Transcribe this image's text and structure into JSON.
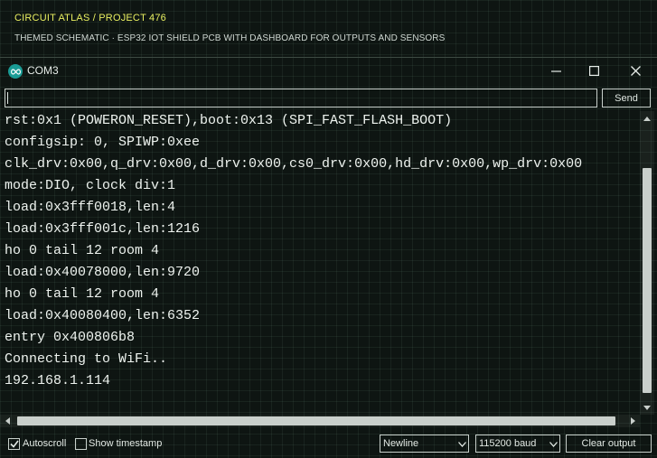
{
  "header": {
    "brand": "CIRCUIT ATLAS / PROJECT 476",
    "subtitle": "THEMED SCHEMATIC · ESP32 IOT SHIELD PCB WITH DASHBOARD FOR OUTPUTS AND SENSORS"
  },
  "window": {
    "title": "COM3",
    "icon": "arduino-infinity-icon",
    "controls": [
      "minimize-icon",
      "maximize-icon",
      "close-icon"
    ]
  },
  "send": {
    "input_value": "",
    "input_placeholder": "",
    "button_label": "Send"
  },
  "output": {
    "lines": [
      "rst:0x1 (POWERON_RESET),boot:0x13 (SPI_FAST_FLASH_BOOT)",
      "configsip: 0, SPIWP:0xee",
      "clk_drv:0x00,q_drv:0x00,d_drv:0x00,cs0_drv:0x00,hd_drv:0x00,wp_drv:0x00",
      "mode:DIO, clock div:1",
      "load:0x3fff0018,len:4",
      "load:0x3fff001c,len:1216",
      "ho 0 tail 12 room 4",
      "load:0x40078000,len:9720",
      "ho 0 tail 12 room 4",
      "load:0x40080400,len:6352",
      "entry 0x400806b8",
      "Connecting to WiFi..",
      "192.168.1.114"
    ],
    "highlight_color": "#e8ee3c"
  },
  "footer": {
    "autoscroll_label": "Autoscroll",
    "autoscroll_checked": true,
    "timestamp_label": "Show timestamp",
    "timestamp_checked": false,
    "line_ending": "Newline",
    "baud": "115200 baud",
    "clear_label": "Clear output"
  },
  "colors": {
    "brand": "#e8ee60",
    "background": "#0e1512",
    "icon_teal": "#1a9b95"
  }
}
